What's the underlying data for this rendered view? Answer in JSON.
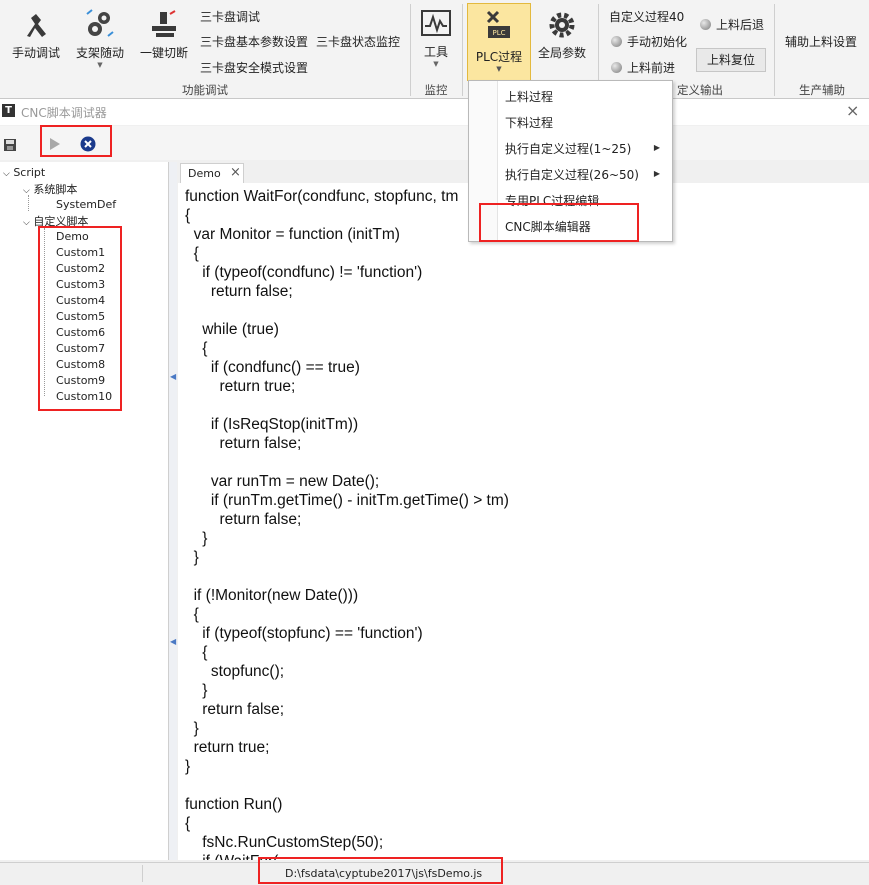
{
  "ribbon": {
    "manual_debug": "手动调试",
    "support_follow": "支架随动",
    "one_key_cut": "一键切断",
    "chuck3_debug": "三卡盘调试",
    "chuck3_basic_params": "三卡盘基本参数设置",
    "chuck3_status_monitor": "三卡盘状态监控",
    "chuck3_safe_mode": "三卡盘安全模式设置",
    "group_function_debug": "功能调试",
    "tools": "工具",
    "group_monitor": "监控",
    "plc_process": "PLC过程",
    "global_params": "全局参数",
    "custom_process_40": "自定义过程40",
    "manual_init": "手动初始化",
    "load_forward": "上料前进",
    "load_back": "上料后退",
    "load_reset": "上料复位",
    "group_custom_output": "定义输出",
    "aux_load_settings": "辅助上料设置",
    "group_production_aux": "生产辅助"
  },
  "menu": {
    "items": [
      "上料过程",
      "下料过程",
      "执行自定义过程(1~25)",
      "执行自定义过程(26~50)",
      "专用PLC过程编辑",
      "CNC脚本编辑器"
    ]
  },
  "window": {
    "title": "CNC脚本调试器",
    "close": "×"
  },
  "tree": {
    "root": "Script",
    "system_scripts": "系统脚本",
    "system_def": "SystemDef",
    "custom_scripts": "自定义脚本",
    "items": [
      "Demo",
      "Custom1",
      "Custom2",
      "Custom3",
      "Custom4",
      "Custom5",
      "Custom6",
      "Custom7",
      "Custom8",
      "Custom9",
      "Custom10"
    ]
  },
  "tab": {
    "label": "Demo"
  },
  "editor": {
    "code": "function WaitFor(condfunc, stopfunc, tm\n{\n  var Monitor = function (initTm)\n  {\n    if (typeof(condfunc) != 'function')\n      return false;\n\n    while (true)\n    {\n      if (condfunc() == true)\n        return true;\n\n      if (IsReqStop(initTm))\n        return false;\n\n      var runTm = new Date();\n      if (runTm.getTime() - initTm.getTime() > tm)\n        return false;\n    }\n  }\n\n  if (!Monitor(new Date()))\n  {\n    if (typeof(stopfunc) == 'function')\n    {\n      stopfunc();\n    }\n    return false;\n  }\n  return true;\n}\n\nfunction Run()\n{\n    fsNc.RunCustomStep(50);\n    if (WaitFor("
  },
  "status": {
    "path": "D:\\fsdata\\cyptube2017\\js\\fsDemo.js"
  },
  "colors": {
    "highlight_red": "#ee2222",
    "plc_active_bg": "#fbe6a0",
    "menu_text": "#222222"
  }
}
